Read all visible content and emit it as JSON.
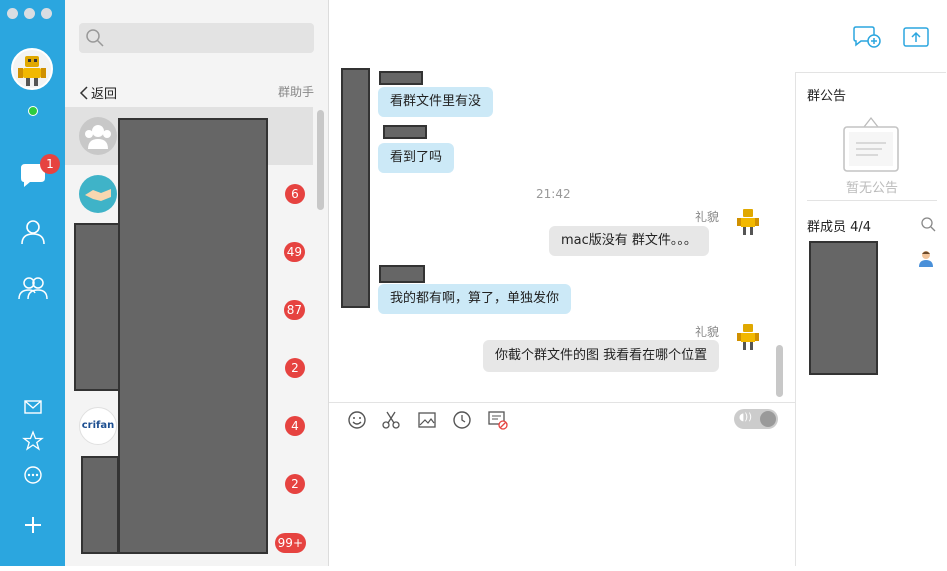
{
  "sidebar": {
    "unread_badge": "1"
  },
  "session_list": {
    "back_label": "返回",
    "group_helper_label": "群助手",
    "items": [
      {
        "badge": ""
      },
      {
        "badge": "6"
      },
      {
        "badge": "49"
      },
      {
        "badge": "87"
      },
      {
        "badge": "2"
      },
      {
        "badge": "4",
        "avatar_text": "crifan"
      },
      {
        "badge": "2"
      },
      {
        "badge": "99+"
      }
    ]
  },
  "chat": {
    "messages": [
      {
        "text": "看群文件里有没",
        "dir": "in"
      },
      {
        "text": "看到了吗",
        "dir": "in"
      },
      {
        "time": "21:42"
      },
      {
        "sender": "礼貌",
        "text": "mac版没有 群文件。。。",
        "dir": "out"
      },
      {
        "text": "我的都有啊，算了，单独发你",
        "dir": "in"
      },
      {
        "sender": "礼貌",
        "text": "你截个群文件的图 我看看在哪个位置",
        "dir": "out"
      }
    ]
  },
  "side_panel": {
    "notice_title": "群公告",
    "notice_empty": "暂无公告",
    "members_title": "群成员 4/4"
  },
  "colors": {
    "rail": "#2ba6df",
    "badge": "#e64340",
    "incoming_bubble": "#cce9f7",
    "outgoing_bubble": "#e7e7e7"
  },
  "icons": [
    "search-icon",
    "chat-icon",
    "contact-icon",
    "group-icon",
    "mail-icon",
    "star-icon",
    "more-icon",
    "plus-icon",
    "add-chat-icon",
    "upload-icon",
    "emoji-icon",
    "scissors-icon",
    "image-icon",
    "clock-icon",
    "history-icon",
    "search-member-icon"
  ]
}
